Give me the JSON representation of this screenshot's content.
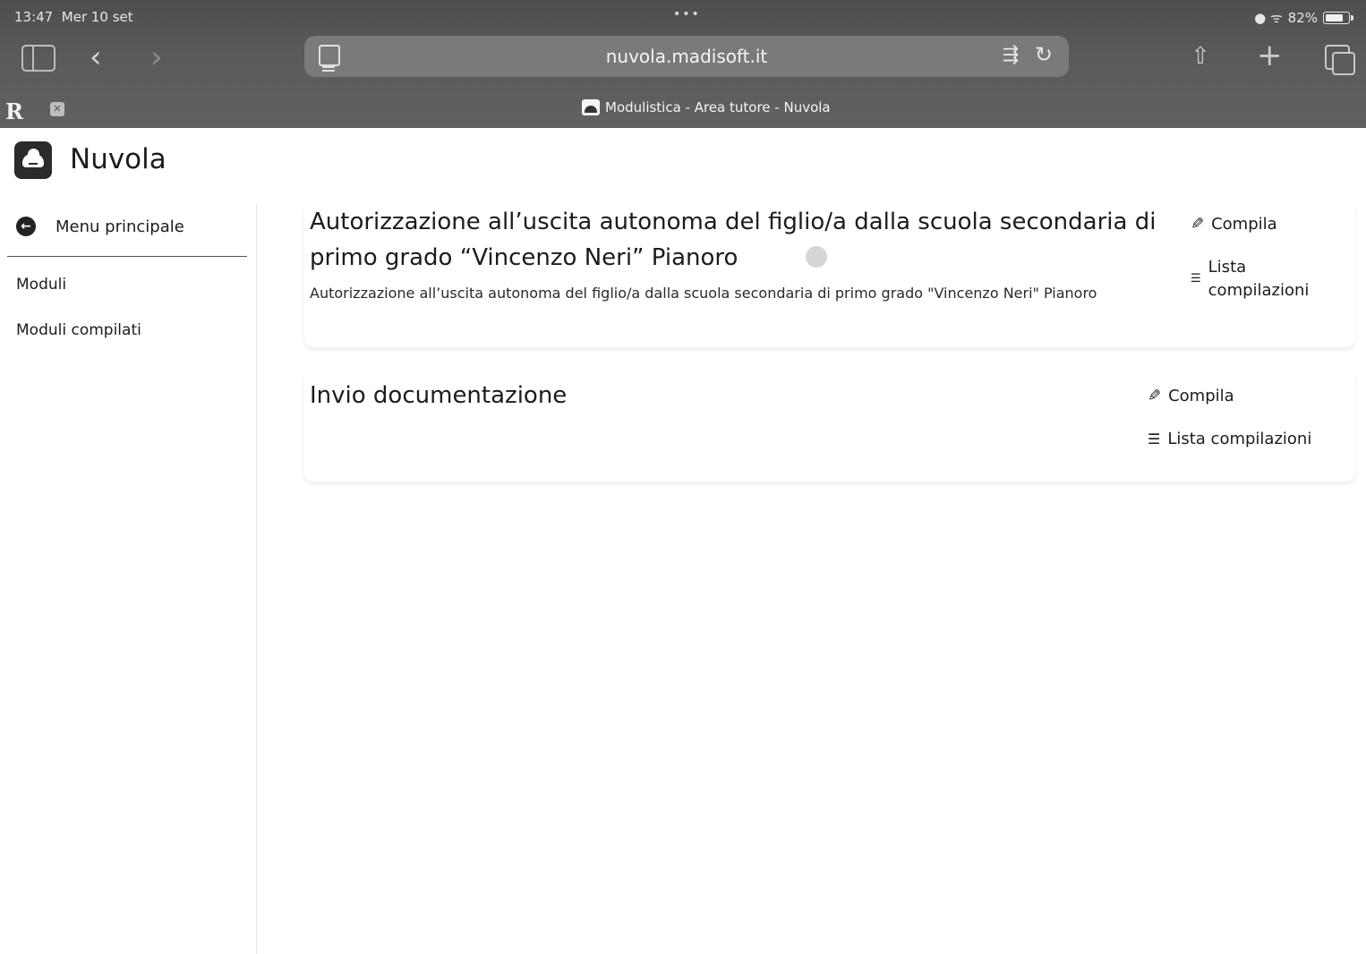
{
  "status_bar": {
    "time": "13:47",
    "date": "Mer 10 set",
    "dots": "•••",
    "battery": "82%"
  },
  "browser": {
    "url": "nuvola.madisoft.it",
    "tab_title": "Modulistica - Area tutore - Nuvola",
    "tab_left_label": "R"
  },
  "app": {
    "name": "Nuvola"
  },
  "sidebar": {
    "back_label": "Menu principale",
    "items": [
      {
        "label": "Moduli"
      },
      {
        "label": "Moduli compilati"
      }
    ]
  },
  "forms": [
    {
      "title": "Autorizzazione all’uscita autonoma del figlio/a dalla scuola secondaria di primo grado “Vincenzo Neri” Pianoro",
      "description": "Autorizzazione all’uscita autonoma del figlio/a dalla scuola secondaria di primo grado \"Vincenzo Neri\" Pianoro",
      "compila_label": "Compila",
      "lista_label": "Lista compilazioni"
    },
    {
      "title": "Invio documentazione",
      "description": "",
      "compila_label": "Compila",
      "lista_label": "Lista compilazioni"
    }
  ]
}
